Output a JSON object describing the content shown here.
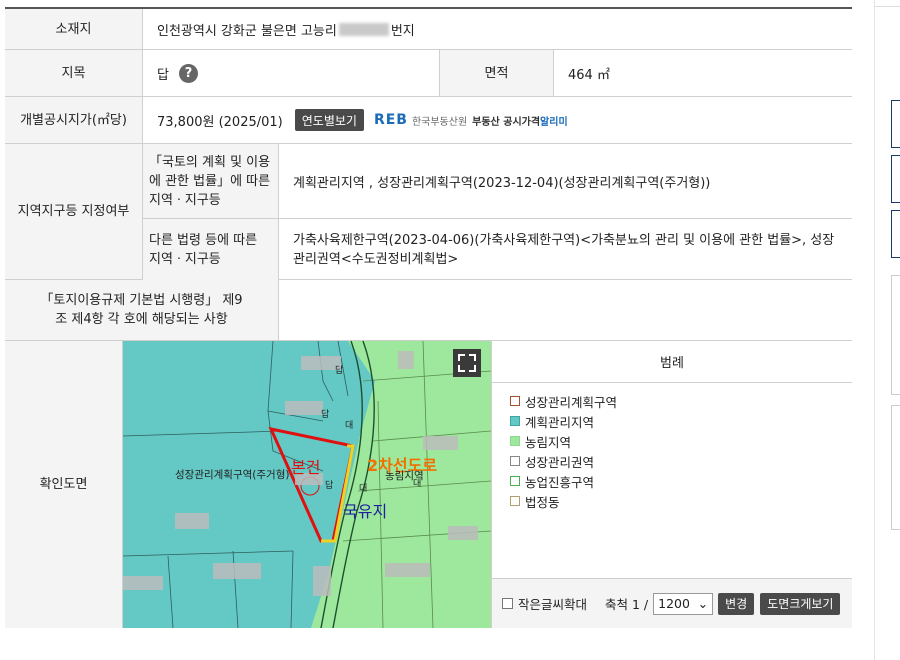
{
  "location": {
    "label": "소재지",
    "value_prefix": "인천광역시 강화군 불은면 고능리",
    "value_suffix": "번지"
  },
  "category": {
    "label": "지목",
    "value": "답",
    "help_icon": "?"
  },
  "area": {
    "label": "면적",
    "value": "464 ㎡"
  },
  "price": {
    "label": "개별공시지가(㎡당)",
    "value": "73,800원 (2025/01)",
    "button": "연도별보기",
    "reb_mark": "REB",
    "reb_org": "한국부동산원",
    "reb_service": "부동산 공시가격",
    "reb_service2": "알리미"
  },
  "zoning": {
    "label": "지역지구등 지정여부",
    "sub1_label": "「국토의 계획 및 이용에 관한 법률」에 따른 지역ㆍ지구등",
    "sub1_value": "계획관리지역 , 성장관리계획구역(2023-12-04)(성장관리계획구역(주거형))",
    "sub2_label": "다른 법령 등에 따른 지역ㆍ지구등",
    "sub2_value": "가축사육제한구역(2023-04-06)(가축사육제한구역)<가축분뇨의 관리 및 이용에 관한 법률>, 성장관리권역<수도권정비계획법>"
  },
  "enforcement": {
    "label": "「토지이용규제 기본법 시행령」 제9조 제4항 각 호에 해당되는 사항",
    "value": ""
  },
  "map": {
    "label": "확인도면",
    "zone_label": "성장관리계획구역(주거형)",
    "annot_subject": "본건",
    "annot_road": "2차선도로",
    "annot_state": "국유지",
    "zone_label2": "농림지역",
    "parcel_marks": [
      "답",
      "답",
      "답",
      "대",
      "대",
      "대"
    ]
  },
  "legend": {
    "title": "범례",
    "items": [
      {
        "label": "성장관리계획구역",
        "color": "#a0522d",
        "fill": "#ffffff"
      },
      {
        "label": "계획관리지역",
        "color": "#3aa7a3",
        "fill": "#64c8c5"
      },
      {
        "label": "농림지역",
        "color": "#8fd98f",
        "fill": "#9de89d"
      },
      {
        "label": "성장관리권역",
        "color": "#888888",
        "fill": "#ffffff"
      },
      {
        "label": "농업진흥구역",
        "color": "#4caf50",
        "fill": "#ffffff"
      },
      {
        "label": "법정동",
        "color": "#b0a070",
        "fill": "#ffffff"
      }
    ]
  },
  "controls": {
    "zoom_text": "작은글씨확대",
    "scale_label": "축척 1 /",
    "scale_value": "1200",
    "change_button": "변경",
    "enlarge_button": "도면크게보기"
  },
  "colors": {
    "zone_teal": "#64c8c5",
    "zone_green": "#9de89d",
    "boundary": "#e01010",
    "road": "#f0d020"
  }
}
